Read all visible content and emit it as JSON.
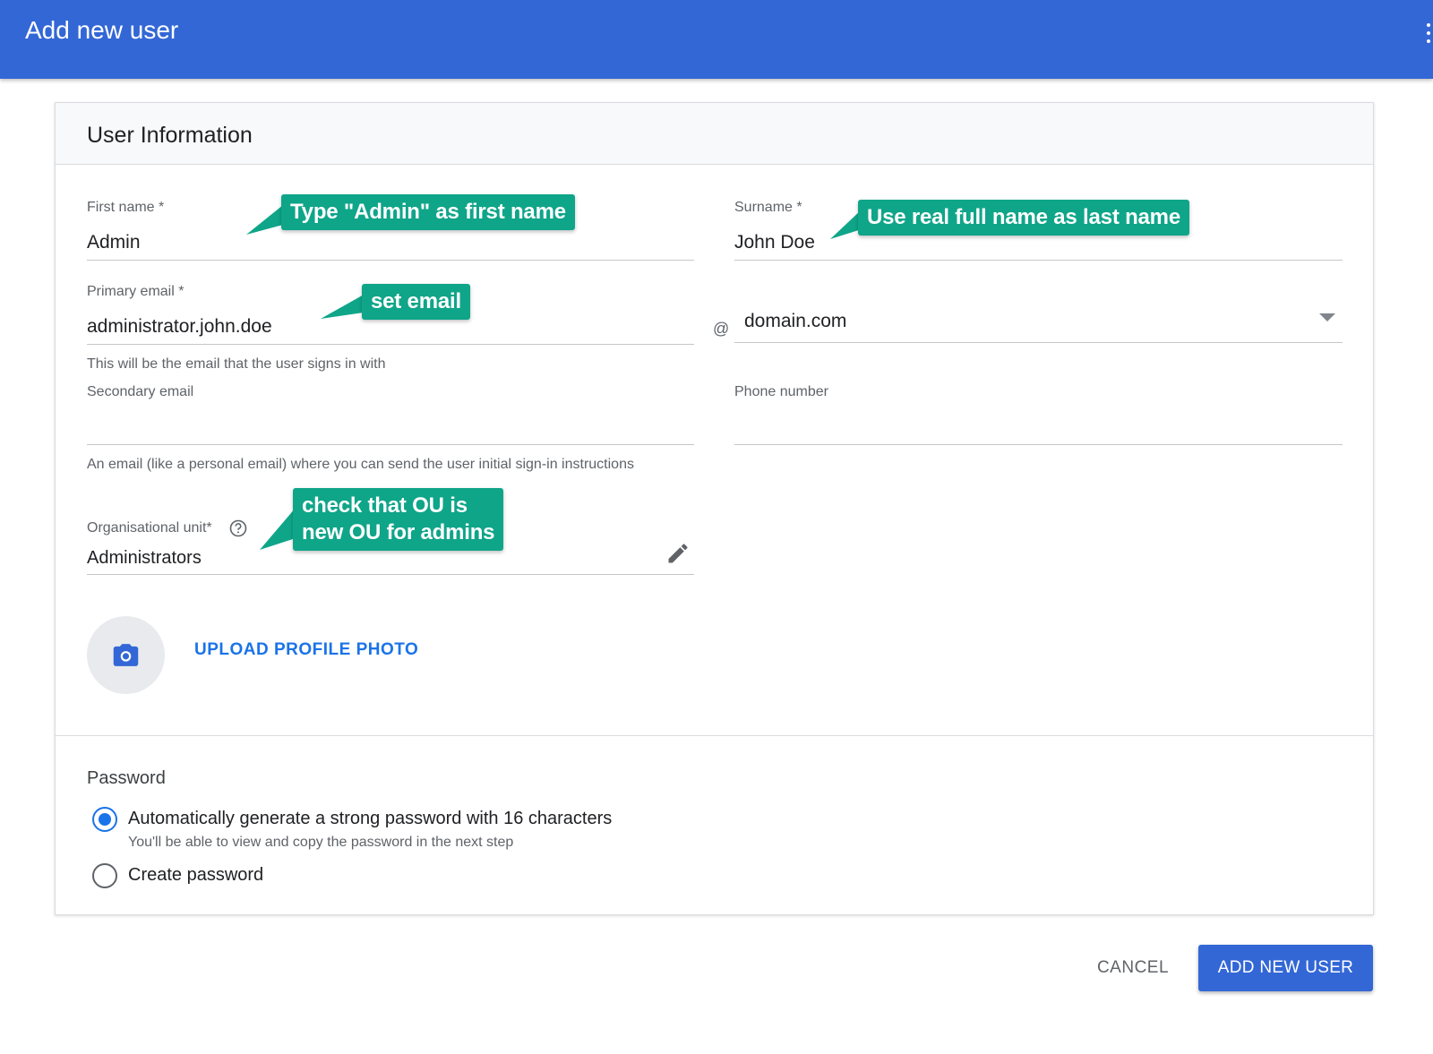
{
  "header": {
    "title": "Add new user"
  },
  "card": {
    "title": "User Information",
    "first_name": {
      "label": "First name *",
      "value": "Admin"
    },
    "surname": {
      "label": "Surname *",
      "value": "John Doe"
    },
    "primary_email": {
      "label": "Primary email *",
      "value": "administrator.john.doe",
      "help": "This will be the email that the user signs in with"
    },
    "domain": {
      "at": "@",
      "value": "domain.com"
    },
    "secondary_email": {
      "label": "Secondary email",
      "value": "",
      "help": "An email (like a personal email) where you can send the user initial sign-in instructions"
    },
    "phone": {
      "label": "Phone number",
      "value": ""
    },
    "org_unit": {
      "label": "Organisational unit*",
      "value": "Administrators"
    },
    "upload_photo": "UPLOAD PROFILE PHOTO",
    "password": {
      "title": "Password",
      "options": [
        {
          "label": "Automatically generate a strong password with 16 characters",
          "sub": "You'll be able to view and copy the password in the next step",
          "selected": true
        },
        {
          "label": "Create password",
          "selected": false
        }
      ]
    }
  },
  "callouts": {
    "first_name": "Type \"Admin\" as first name",
    "surname": "Use real full name as last name",
    "email": "set email",
    "ou_line1": "check that OU is",
    "ou_line2": "new OU for admins"
  },
  "footer": {
    "cancel": "CANCEL",
    "add": "ADD NEW USER"
  },
  "colors": {
    "primary": "#3367d6",
    "callout": "#0fa589",
    "link": "#1a73e8"
  }
}
